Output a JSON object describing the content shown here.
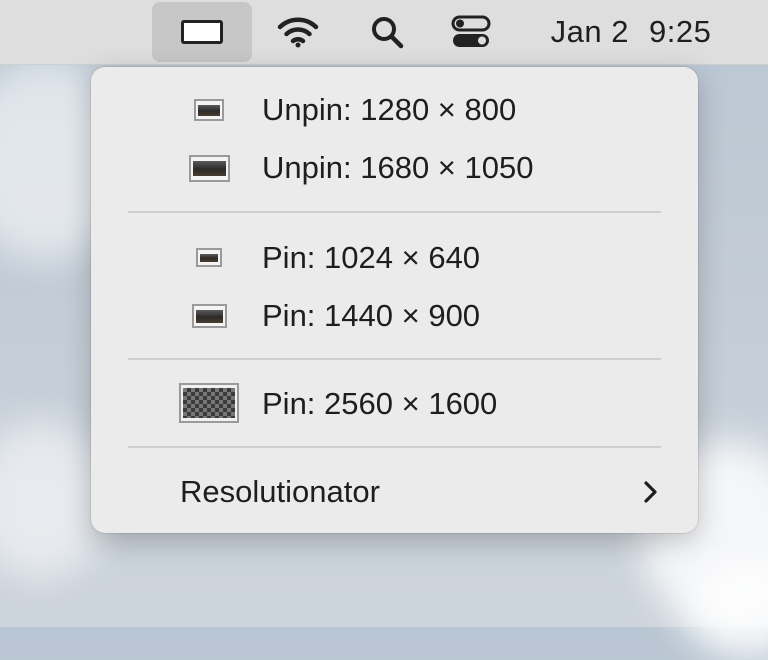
{
  "menubar": {
    "display_icon": "display-icon",
    "wifi_icon": "wifi-icon",
    "search_icon": "search-icon",
    "control_icon": "control-center-icon",
    "date": "Jan 2",
    "time": "9:25"
  },
  "menu": {
    "unpin_group": [
      {
        "label": "Unpin: 1280 × 800"
      },
      {
        "label": "Unpin: 1680 × 1050"
      }
    ],
    "pin_group": [
      {
        "label": "Pin: 1024 × 640"
      },
      {
        "label": "Pin: 1440 × 900"
      }
    ],
    "native_group": [
      {
        "label": "Pin: 2560 × 1600"
      }
    ],
    "app": {
      "label": "Resolutionator",
      "icon": "chevron-right-icon"
    }
  }
}
